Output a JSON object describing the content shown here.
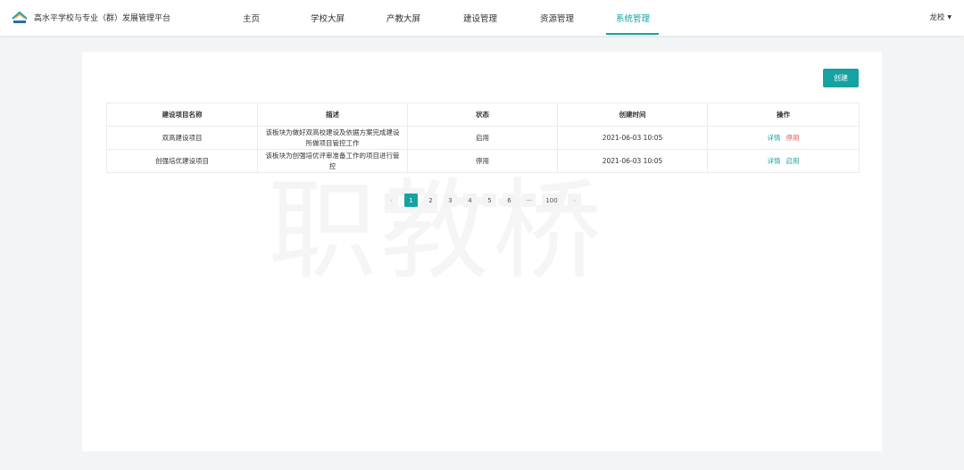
{
  "header": {
    "app_title": "高水平学校与专业（群）发展管理平台",
    "logo_icon": "school-logo-icon",
    "nav": [
      {
        "label": "主页"
      },
      {
        "label": "学校大屏"
      },
      {
        "label": "产教大屏"
      },
      {
        "label": "建设管理"
      },
      {
        "label": "资源管理"
      },
      {
        "label": "系统管理"
      }
    ],
    "active_nav": "系统管理",
    "user_name": "龙校",
    "user_caret": "▼"
  },
  "toolbar": {
    "create_label": "创建"
  },
  "watermark": "职教桥",
  "table": {
    "columns": [
      "建设项目名称",
      "描述",
      "状态",
      "创建时间",
      "操作"
    ],
    "rows": [
      {
        "name": "双高建设项目",
        "desc": "该板块为做好双高校建设及依据方案完成建设所做项目管控工作",
        "status": "启用",
        "created": "2021-06-03 10:05",
        "op_detail": "详情",
        "op_toggle": "停用"
      },
      {
        "name": "创强培优建设项目",
        "desc": "该板块为创强培优评审准备工作的项目进行管控",
        "status": "停用",
        "created": "2021-06-03 10:05",
        "op_detail": "详情",
        "op_toggle": "启用"
      }
    ]
  },
  "pagination": {
    "prev": "‹",
    "pages": [
      "1",
      "2",
      "3",
      "4",
      "5",
      "6",
      "···",
      "100"
    ],
    "current": "1",
    "next": "›"
  },
  "colors": {
    "accent": "#17a2a2",
    "danger": "#e05454"
  }
}
